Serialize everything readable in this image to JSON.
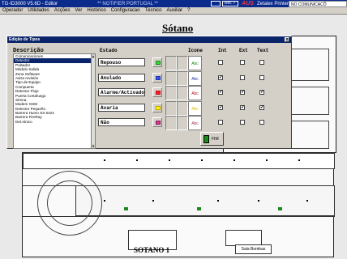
{
  "titlebar": {
    "app": "TG-ID3000 V5.6D - Editor",
    "center": "** NOTIFIER PORTUGAL **",
    "box1": "",
    "box2": "Rec ✓",
    "logo": "AUS",
    "zetalex": "Zetalex Printer",
    "status": "NO COMUNICACÕ"
  },
  "menu": [
    "Operador",
    "Utilidades",
    "Acções",
    "Ver",
    "Histórico",
    "Configuracao",
    "Técnico",
    "Auxiliar",
    "?"
  ],
  "floor_title": "Sótano",
  "plan_label": "SOTANO 1",
  "sala_label": "Sala Bombas",
  "dialog": {
    "title": "Edição de Tipos",
    "close": "x",
    "desc_header": "Descrição",
    "headers": {
      "estado": "Estado",
      "icone": "Icone",
      "int": "Int",
      "ext": "Ext",
      "text": "Text"
    },
    "descriptions": [
      "Comunicaciones",
      "Detector",
      "Pulsador",
      "Módulo Salida",
      "Zona Software",
      "Aviso revisión",
      "Tipo de Equipo",
      "Compuerta",
      "Detector Flujo",
      "Puerta Cortafuego",
      "Sirena",
      "Modem GSM",
      "Detector Pequeño",
      "Barrera Humo SS 6424",
      "Barrera FireRay",
      "Det.Iónico"
    ],
    "selected_index": 1,
    "states": [
      {
        "label": "Repouso",
        "icon_color": "#1e8a1e",
        "abc_color": "#1e8a1e",
        "int": false,
        "ext": false,
        "text": false
      },
      {
        "label": "Anulado",
        "icon_color": "#2233aa",
        "abc_color": "#2233aa",
        "int": true,
        "ext": false,
        "text": false
      },
      {
        "label": "Alarme/Activado",
        "icon_color": "#c0101a",
        "abc_color": "#c0101a",
        "int": true,
        "ext": true,
        "text": true
      },
      {
        "label": "Avaria",
        "icon_color": "#c0a000",
        "abc_color": "#e0c000",
        "int": true,
        "ext": true,
        "text": true
      },
      {
        "label": "Não",
        "icon_color": "#8a1e5a",
        "abc_color": "#aa3366",
        "int": false,
        "ext": false,
        "text": false
      }
    ],
    "fim_label": "FIM"
  }
}
